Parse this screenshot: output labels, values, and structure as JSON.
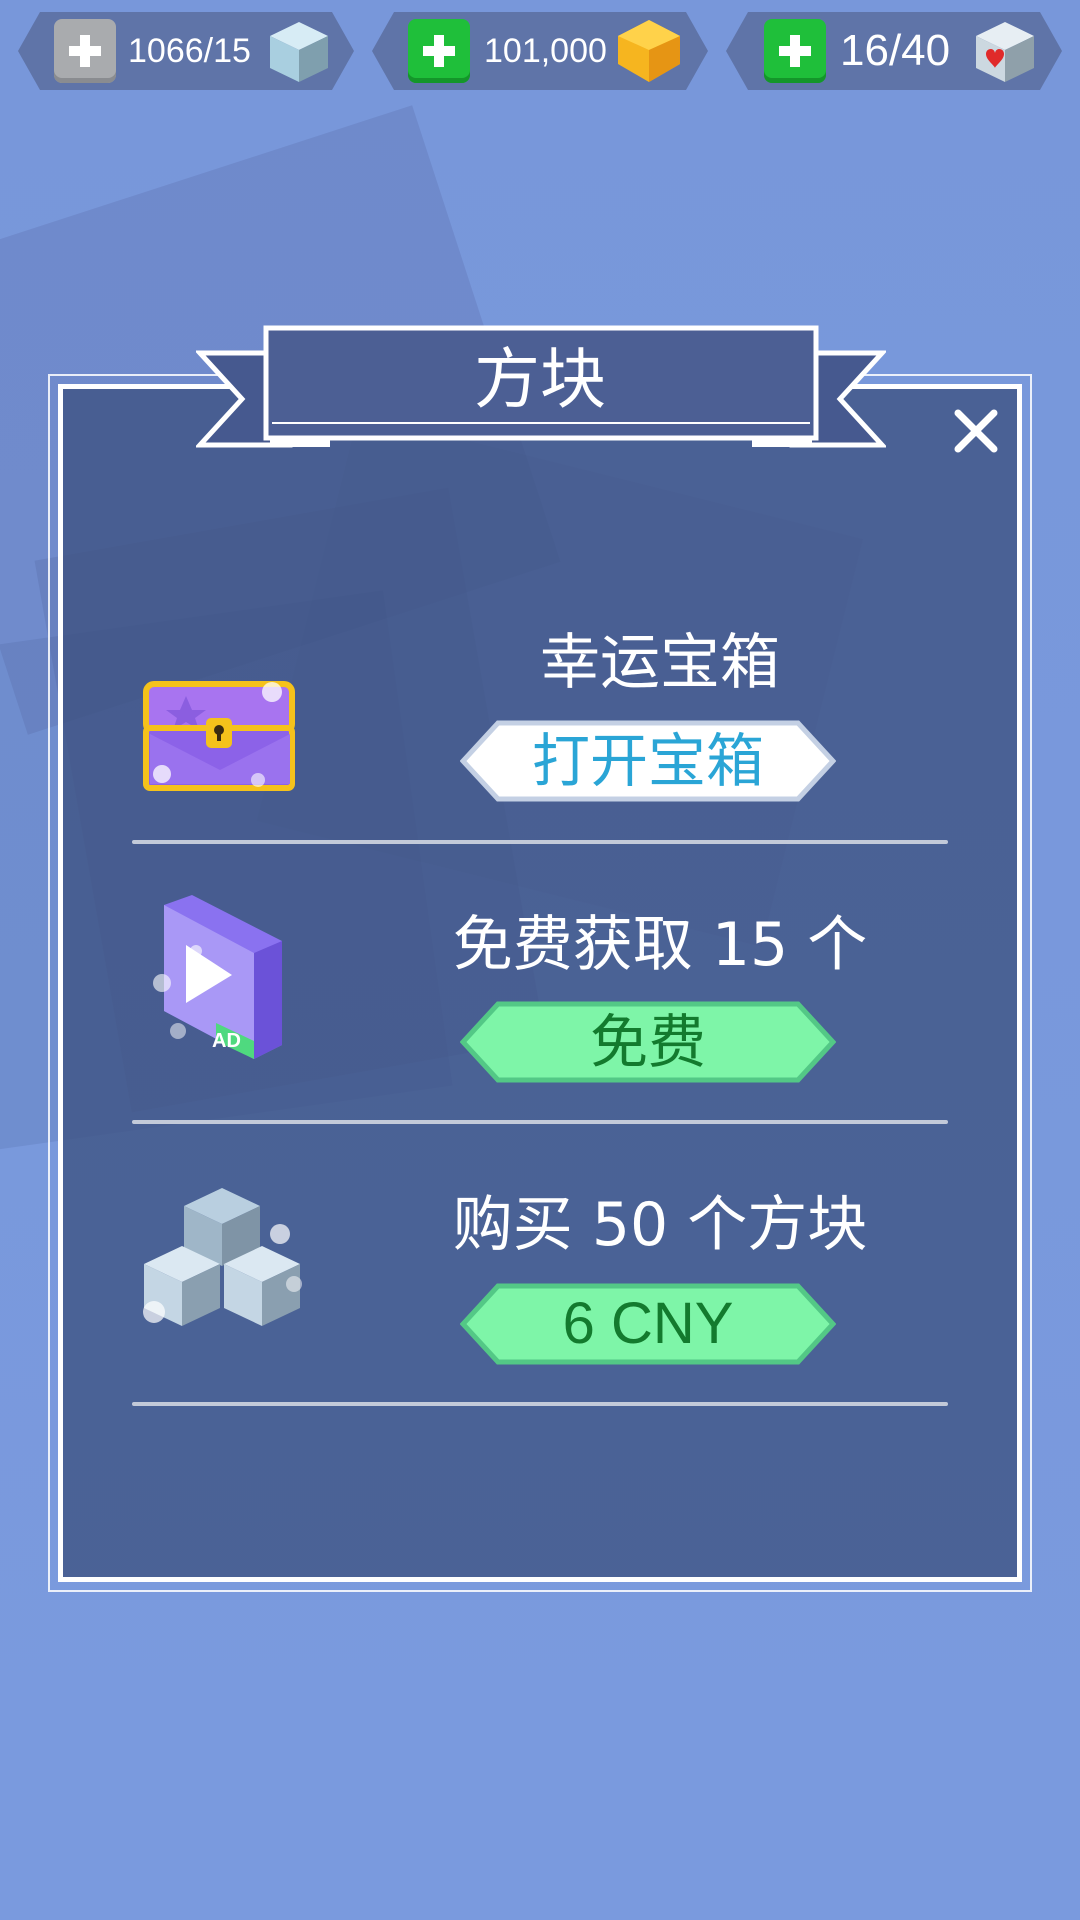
{
  "top_bar": {
    "blocks": {
      "value": "1066/15",
      "icon": "ice-cube-icon"
    },
    "coins": {
      "value": "101,000",
      "icon": "gold-gem-icon"
    },
    "lives": {
      "value": "16/40",
      "icon": "heart-cube-icon"
    }
  },
  "panel": {
    "title": "方块",
    "close_icon": "close-icon"
  },
  "offers": [
    {
      "title": "幸运宝箱",
      "button": "打开宝箱",
      "icon": "treasure-chest-icon",
      "button_style": "white"
    },
    {
      "title": "免费获取 15 个",
      "button": "免费",
      "icon": "video-ad-icon",
      "ad_label": "AD",
      "button_style": "green"
    },
    {
      "title": "购买 50 个方块",
      "button": "6 CNY",
      "icon": "cube-stack-icon",
      "button_style": "green"
    }
  ],
  "colors": {
    "background": "#7897da",
    "panel": "#3e5282",
    "green_button": "#7ef5a8",
    "green_text": "#137a2e",
    "white_button_text": "#2aa5d6"
  }
}
